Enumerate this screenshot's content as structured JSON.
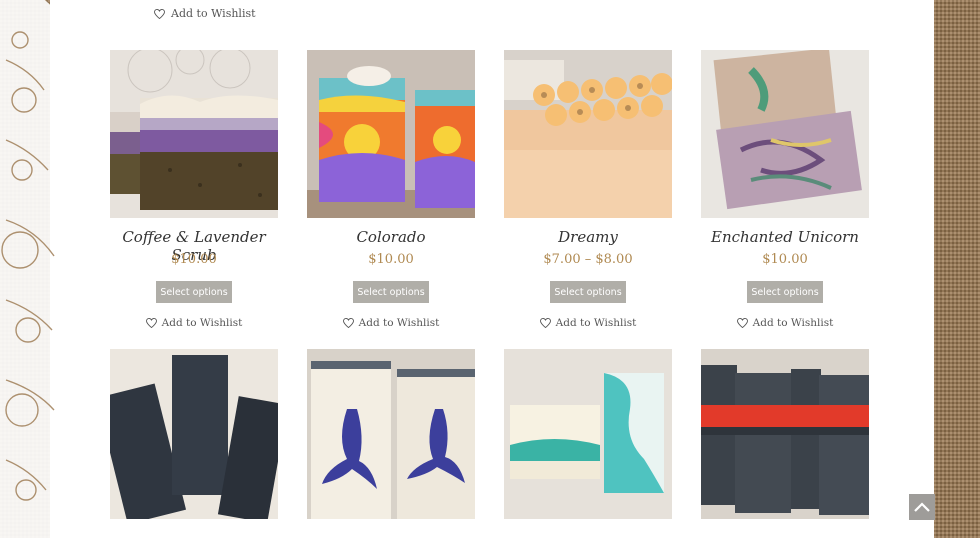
{
  "top_wishlist": "Add to Wishlist",
  "products_row1": [
    {
      "title": "Coffee & Lavender Scrub",
      "price": "$10.00",
      "button": "Select options",
      "wishlist": "Add to Wishlist"
    },
    {
      "title": "Colorado",
      "price": "$10.00",
      "button": "Select options",
      "wishlist": "Add to Wishlist"
    },
    {
      "title": "Dreamy",
      "price": "$7.00 – $8.00",
      "button": "Select options",
      "wishlist": "Add to Wishlist"
    },
    {
      "title": "Enchanted Unicorn",
      "price": "$10.00",
      "button": "Select options",
      "wishlist": "Add to Wishlist"
    }
  ],
  "colors": {
    "price": "#b08a52",
    "button_bg": "#b0aea8",
    "burlap": "#9c7a52"
  },
  "icons": {
    "wishlist": "heart-icon",
    "scroll_top": "chevron-up-icon"
  }
}
